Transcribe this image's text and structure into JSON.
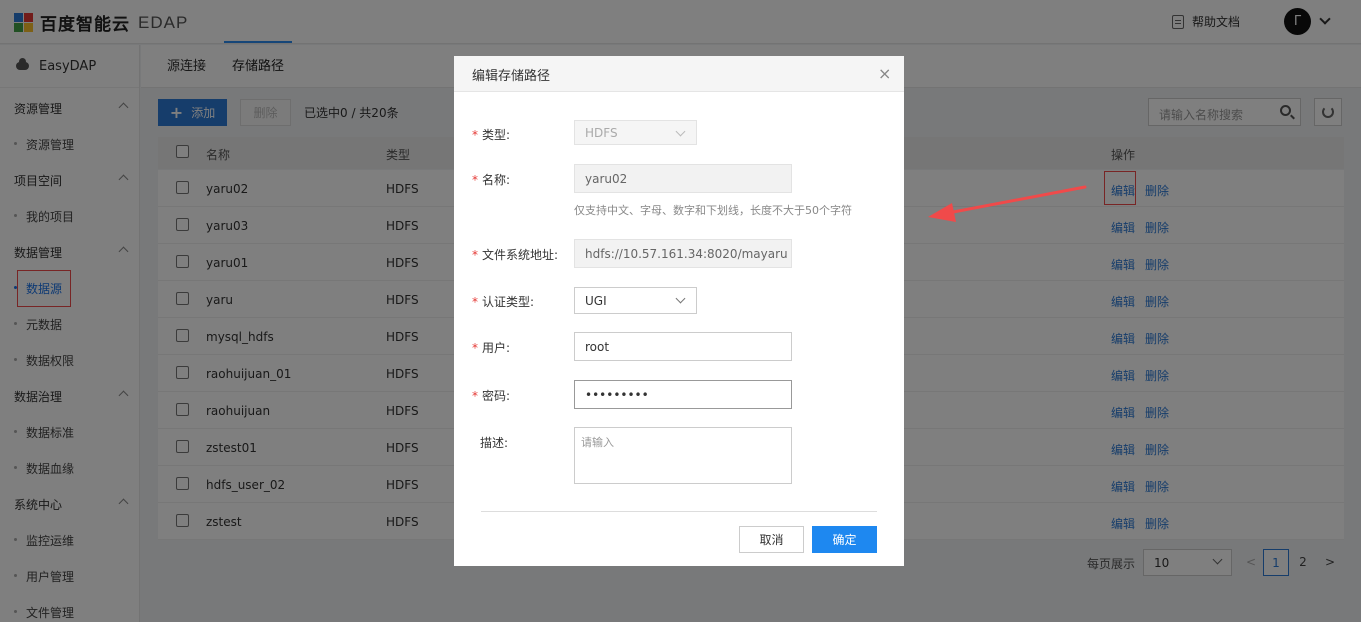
{
  "header": {
    "logo_text": "百度智能云",
    "product": "EDAP",
    "help_label": "帮助文档",
    "avatar_letter": "Γ"
  },
  "sidebar": {
    "brand": "EasyDAP",
    "groups": [
      {
        "title": "资源管理",
        "items": [
          "资源管理"
        ]
      },
      {
        "title": "项目空间",
        "items": [
          "我的项目"
        ]
      },
      {
        "title": "数据管理",
        "items": [
          "数据源",
          "元数据",
          "数据权限"
        ]
      },
      {
        "title": "数据治理",
        "items": [
          "数据标准",
          "数据血缘"
        ]
      },
      {
        "title": "系统中心",
        "items": [
          "监控运维",
          "用户管理",
          "文件管理"
        ]
      }
    ],
    "active_item": "数据源"
  },
  "tabs": [
    "源连接",
    "存储路径"
  ],
  "toolbar": {
    "add_label": "添加",
    "delete_label": "删除",
    "selection_info": "已选中0 / 共20条",
    "search_placeholder": "请输入名称搜索"
  },
  "table": {
    "columns": [
      "名称",
      "类型",
      "操作"
    ],
    "rows": [
      {
        "name": "yaru02",
        "type": "HDFS"
      },
      {
        "name": "yaru03",
        "type": "HDFS"
      },
      {
        "name": "yaru01",
        "type": "HDFS"
      },
      {
        "name": "yaru",
        "type": "HDFS"
      },
      {
        "name": "mysql_hdfs",
        "type": "HDFS"
      },
      {
        "name": "raohuijuan_01",
        "type": "HDFS"
      },
      {
        "name": "raohuijuan",
        "type": "HDFS"
      },
      {
        "name": "zstest01",
        "type": "HDFS"
      },
      {
        "name": "hdfs_user_02",
        "type": "HDFS"
      },
      {
        "name": "zstest",
        "type": "HDFS"
      }
    ],
    "action_edit": "编辑",
    "action_delete": "删除"
  },
  "pagination": {
    "per_page_label": "每页展示",
    "per_page_value": "10",
    "prev": "<",
    "pages": [
      "1",
      "2"
    ],
    "current_page": "1",
    "next": ">"
  },
  "modal": {
    "title": "编辑存储路径",
    "close": "×",
    "fields": {
      "type_label": "类型:",
      "type_value": "HDFS",
      "name_label": "名称:",
      "name_value": "yaru02",
      "name_hint": "仅支持中文、字母、数字和下划线，长度不大于50个字符",
      "fs_label": "文件系统地址:",
      "fs_value": "hdfs://10.57.161.34:8020/mayaru",
      "auth_label": "认证类型:",
      "auth_value": "UGI",
      "user_label": "用户:",
      "user_value": "root",
      "password_label": "密码:",
      "password_value": "•••••••••",
      "desc_label": "描述:",
      "desc_placeholder": "请输入"
    },
    "required_mark": "*",
    "cancel_label": "取消",
    "ok_label": "确定"
  },
  "colors": {
    "primary": "#2d7ad6",
    "confirm": "#1e88f0",
    "annotation": "#f04a4a"
  }
}
